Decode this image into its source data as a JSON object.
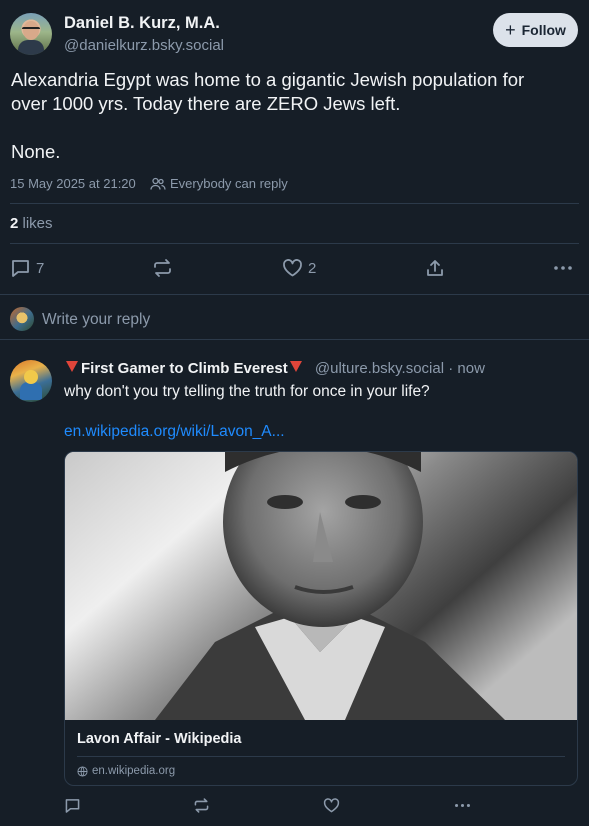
{
  "post": {
    "author_name": "Daniel B. Kurz, M.A.",
    "author_handle": "@danielkurz.bsky.social",
    "follow_label": "Follow",
    "text_line1": "Alexandria Egypt was home to a gigantic Jewish population for",
    "text_line2": "over 1000 yrs. Today there are ZERO Jews left.",
    "text_line3": "None.",
    "timestamp": "15 May 2025 at 21:20",
    "reply_setting": "Everybody can reply",
    "likes_count": "2",
    "likes_label": "likes",
    "reply_count": "7",
    "like_count_action": "2"
  },
  "composer": {
    "placeholder": "Write your reply"
  },
  "reply": {
    "author_name": "First Gamer to Climb Everest",
    "author_handle": "@ulture.bsky.social",
    "time": "now",
    "text": "why don't you try telling the truth for once in your life?",
    "link_text": "en.wikipedia.org/wiki/Lavon_A...",
    "card_title": "Lavon Affair - Wikipedia",
    "card_domain": "en.wikipedia.org"
  },
  "icons": [
    "plus-icon",
    "people-icon",
    "reply-icon",
    "repost-icon",
    "heart-icon",
    "share-icon",
    "more-icon",
    "globe-icon",
    "red-triangle-icon"
  ],
  "colors": {
    "background": "#161e27",
    "accent_link": "#1f8bfe",
    "muted": "#8c9aab",
    "follow_bg": "#dce2ea"
  }
}
